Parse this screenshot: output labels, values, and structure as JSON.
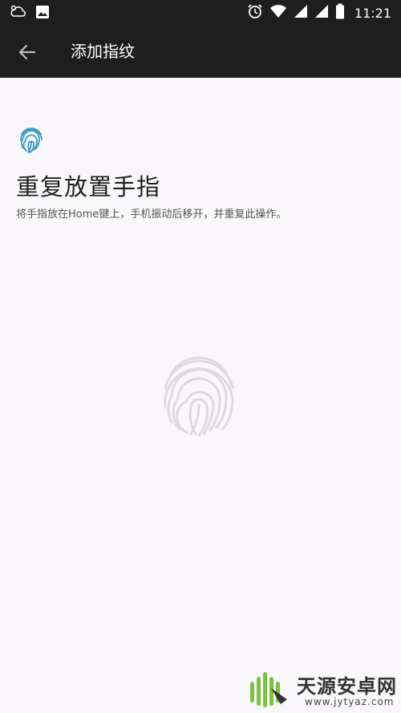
{
  "status_bar": {
    "time": "11:21",
    "left_icons": [
      "weather-icon",
      "image-icon"
    ],
    "right_icons": [
      "alarm-icon",
      "wifi-icon",
      "signal-icon",
      "signal-icon",
      "battery-icon"
    ]
  },
  "app_bar": {
    "title": "添加指纹",
    "back_icon": "arrow-back-icon"
  },
  "main": {
    "heading": "重复放置手指",
    "instruction": "将手指放在Home键上，手机振动后移开，并重复此操作。",
    "small_icon": "fingerprint-icon",
    "large_icon": "fingerprint-icon"
  },
  "watermark": {
    "brand": "天源安卓网",
    "url": "www.jytyaz.com"
  },
  "colors": {
    "status_bar_bg": "#1f1e1f",
    "app_bar_bg": "#1f1e1f",
    "background": "#f9f7fa",
    "fingerprint_accent": "#3a9bc0",
    "fingerprint_faded": "#d9d7da",
    "logo_green": "#7cc242"
  }
}
